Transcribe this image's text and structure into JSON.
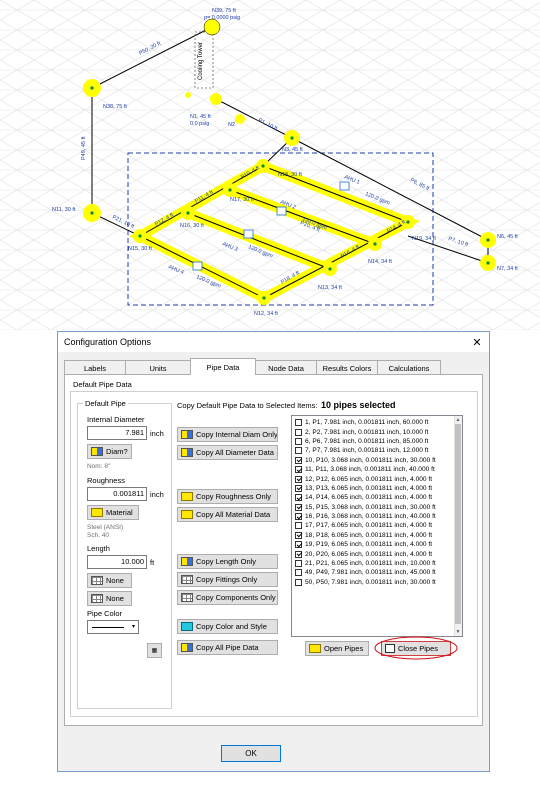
{
  "canvas": {
    "nodes": [
      {
        "id": "n39",
        "label": "N39, 75 ft",
        "sub": "p= 0.0000 psig"
      },
      {
        "id": "n38",
        "label": "N38, 75 ft",
        "sub": ""
      },
      {
        "id": "n1",
        "label": "N1, 45 ft",
        "sub": "0.0 psig"
      },
      {
        "id": "n3",
        "label": "N3, 45 ft",
        "sub": ""
      },
      {
        "id": "n18",
        "label": "N18, 30 ft",
        "sub": ""
      },
      {
        "id": "n17",
        "label": "N17, 30 ft",
        "sub": ""
      },
      {
        "id": "n16",
        "label": "N16, 30 ft",
        "sub": ""
      },
      {
        "id": "n15",
        "label": "N15, 30 ft",
        "sub": ""
      },
      {
        "id": "n11",
        "label": "N11, 30 ft",
        "sub": ""
      },
      {
        "id": "n14",
        "label": "N14, 34 ft",
        "sub": ""
      },
      {
        "id": "n13",
        "label": "N13, 34 ft",
        "sub": ""
      },
      {
        "id": "n12",
        "label": "N12, 34 ft",
        "sub": ""
      },
      {
        "id": "n19",
        "label": "N19, 34 ft",
        "sub": ""
      },
      {
        "id": "n6",
        "label": "N6, 45 ft",
        "sub": ""
      },
      {
        "id": "n7",
        "label": "N7, 34 ft",
        "sub": ""
      }
    ],
    "pipe_labels": [
      "P50, 20 ft",
      "P49, 45 ft",
      "P1, 10 ft",
      "P6, 85 ft",
      "P7, 10 ft",
      "P21, 10 ft",
      "P10, 4 ft",
      "P11, 4 ft",
      "P12, 4 ft",
      "P14, 4 ft",
      "P16, 4 ft",
      "P18, 4 ft",
      "P20, 4 ft"
    ],
    "equipment": [
      {
        "id": "ahu1",
        "label": "AHU 1"
      },
      {
        "id": "ahu2",
        "label": "AHU 2"
      },
      {
        "id": "ahu3",
        "label": "AHU 3"
      },
      {
        "id": "ahu4",
        "label": "AHU 4"
      },
      {
        "id": "tower",
        "label": "Cooling Tower"
      },
      {
        "id": "pump",
        "label": "N2"
      }
    ],
    "flow_labels": [
      "120.0 gpm",
      "120.0 gpm",
      "120.0 gpm",
      "120.0 gpm"
    ]
  },
  "dialog": {
    "title": "Configuration Options",
    "close_glyph": "✕",
    "tabs": [
      "Labels",
      "Units",
      "Pipe Data",
      "Node Data",
      "Results Colors",
      "Calculations"
    ],
    "active_tab": "Pipe Data",
    "outer_group": "Default Pipe Data",
    "default_pipe": {
      "group_label": "Default Pipe",
      "internal_diameter_label": "Internal Diameter",
      "internal_diameter_value": "7.981",
      "diameter_unit": "inch",
      "diam_button": "Diam?",
      "nom_label": "Nom: 8\"",
      "roughness_label": "Roughness",
      "roughness_value": "0.001811",
      "roughness_unit": "inch",
      "material_button": "Material",
      "material_line1": "Steel (ANSI)",
      "material_line2": "Sch. 40",
      "length_label": "Length",
      "length_value": "10.000",
      "length_unit": "ft",
      "fittings_button": "None",
      "components_button": "None",
      "pipe_color_label": "Pipe Color"
    },
    "copy_group_label": "Copy Default Pipe Data to Selected Items:",
    "selected_count": "10 pipes selected",
    "copy_buttons": {
      "internal_diam": "Copy Internal Diam Only",
      "all_diameter": "Copy All Diameter Data",
      "roughness": "Copy Roughness Only",
      "all_material": "Copy All Material Data",
      "length": "Copy Length Only",
      "fittings": "Copy Fittings Only",
      "components": "Copy Components Only",
      "color_style": "Copy Color and Style",
      "all_pipe": "Copy All Pipe Data"
    },
    "pipes": [
      {
        "label": "1, P1, 7.981 inch, 0.001811 inch, 60.000 ft",
        "checked": false
      },
      {
        "label": "2, P2, 7.981 inch, 0.001811 inch, 10.000 ft",
        "checked": false
      },
      {
        "label": "6, P6, 7.981 inch, 0.001811 inch, 85.000 ft",
        "checked": false
      },
      {
        "label": "7, P7, 7.981 inch, 0.001811 inch, 12.000 ft",
        "checked": false
      },
      {
        "label": "10, P10, 3.068 inch, 0.001811 inch, 30.000 ft",
        "checked": true
      },
      {
        "label": "11, P11, 3.068 inch, 0.001811 inch, 40.000 ft",
        "checked": true
      },
      {
        "label": "12, P12, 6.065 inch, 0.001811 inch, 4.000 ft",
        "checked": true
      },
      {
        "label": "13, P13, 6.065 inch, 0.001811 inch, 4.000 ft",
        "checked": true
      },
      {
        "label": "14, P14, 6.065 inch, 0.001811 inch, 4.000 ft",
        "checked": true
      },
      {
        "label": "15, P15, 3.068 inch, 0.001811 inch, 30.000 ft",
        "checked": true
      },
      {
        "label": "16, P16, 3.068 inch, 0.001811 inch, 40.000 ft",
        "checked": true
      },
      {
        "label": "17, P17, 6.065 inch, 0.001811 inch, 4.000 ft",
        "checked": false
      },
      {
        "label": "18, P18, 6.065 inch, 0.001811 inch, 4.000 ft",
        "checked": true
      },
      {
        "label": "19, P19, 6.065 inch, 0.001811 inch, 4.000 ft",
        "checked": true
      },
      {
        "label": "20, P20, 6.065 inch, 0.001811 inch, 4.000 ft",
        "checked": true
      },
      {
        "label": "21, P21, 6.065 inch, 0.001811 inch, 10.000 ft",
        "checked": false
      },
      {
        "label": "49, P49, 7.981 inch, 0.001811 inch, 45.000 ft",
        "checked": false
      },
      {
        "label": "50, P50, 7.981 inch, 0.001811 inch, 30.000 ft",
        "checked": false
      }
    ],
    "open_pipes_button": "Open Pipes",
    "close_pipes_button": "Close Pipes",
    "ok_button": "OK",
    "colors": {
      "highlight": "#ffff00",
      "pipe": "#000000",
      "selection": "#1f3ea8",
      "label": "#1f3ea8",
      "annotation": "#d01010"
    }
  }
}
